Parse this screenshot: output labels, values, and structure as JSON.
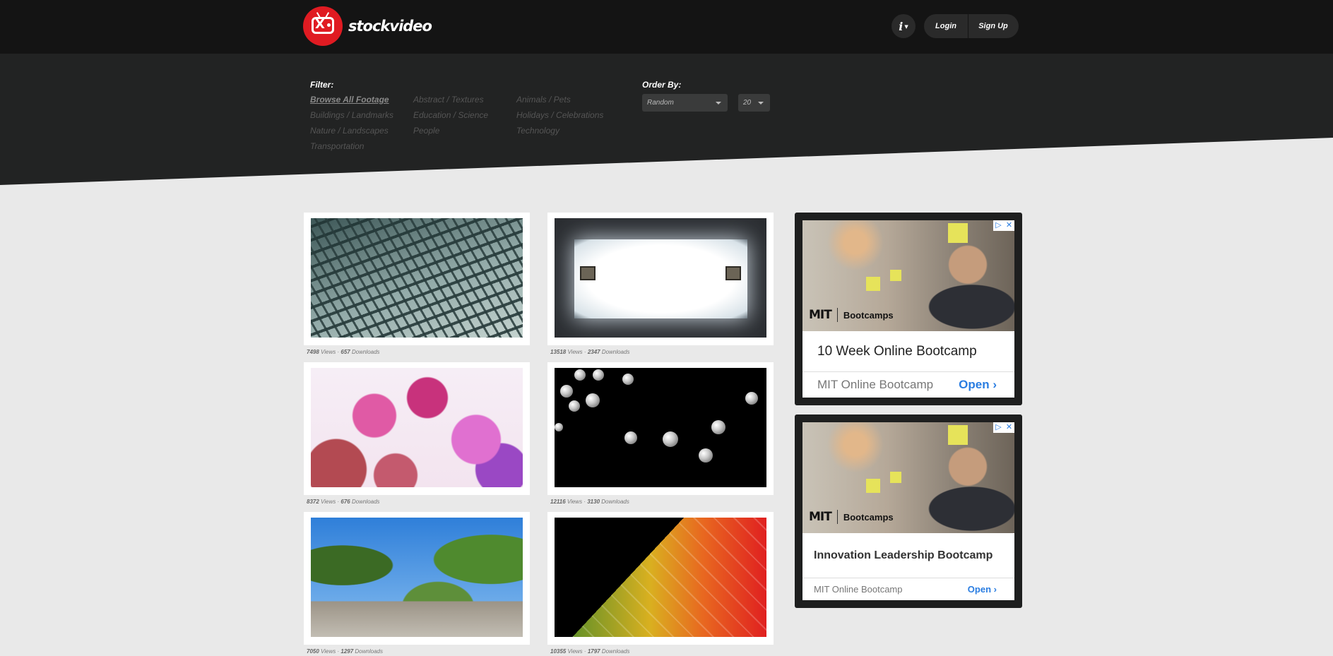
{
  "header": {
    "logo_text": "stockvideo",
    "info_label": "i",
    "login_label": "Login",
    "signup_label": "Sign Up"
  },
  "filter": {
    "title": "Filter:",
    "categories": [
      "Browse All Footage",
      "Abstract / Textures",
      "Animals / Pets",
      "Buildings / Landmarks",
      "Education / Science",
      "Holidays / Celebrations",
      "Nature / Landscapes",
      "People",
      "Technology",
      "Transportation"
    ],
    "active": "Browse All Footage"
  },
  "order": {
    "title": "Order By:",
    "sort_value": "Random",
    "count_value": "20"
  },
  "videos": [
    {
      "views": "7498",
      "downloads": "657"
    },
    {
      "views": "13518",
      "downloads": "2347"
    },
    {
      "views": "8372",
      "downloads": "676"
    },
    {
      "views": "12116",
      "downloads": "3130"
    },
    {
      "views": "7050",
      "downloads": "1297"
    },
    {
      "views": "10355",
      "downloads": "1797"
    }
  ],
  "stats_labels": {
    "views": "Views",
    "separator": "·",
    "downloads": "Downloads"
  },
  "ads": [
    {
      "brand_logo": "MIT",
      "brand": "Bootcamps",
      "headline": "10 Week Online Bootcamp",
      "source": "MIT Online Bootcamp",
      "cta": "Open"
    },
    {
      "brand_logo": "MIT",
      "brand": "Bootcamps",
      "headline": "Innovation Leadership Bootcamp",
      "source": "MIT Online Bootcamp",
      "cta": "Open"
    }
  ],
  "ad_controls": {
    "adchoices": "▷",
    "close": "✕"
  }
}
